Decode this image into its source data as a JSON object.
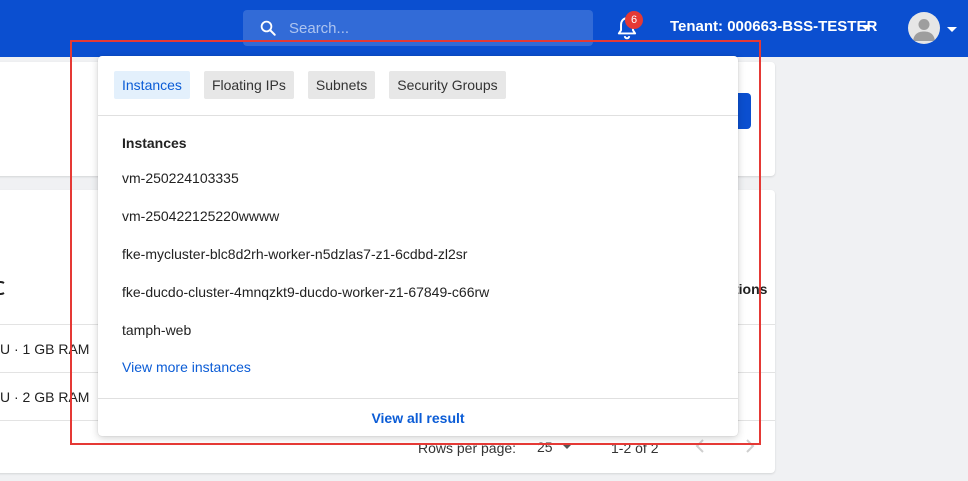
{
  "header": {
    "search_placeholder": "Search...",
    "notification_count": "6",
    "tenant_label": "Tenant: 000663-BSS-TESTER",
    "icons": {
      "search": "search-icon",
      "bell": "bell-icon",
      "avatar": "user-avatar-icon",
      "caret": "caret-down-icon"
    },
    "colors": {
      "brand": "#0b4fd0",
      "badge": "#e53935"
    }
  },
  "background": {
    "column_header_actions": "tions",
    "rows": [
      {
        "spec": "U · 1 GB RAM"
      },
      {
        "spec": "U · 2 GB RAM"
      }
    ],
    "pagination": {
      "rows_per_page_label": "Rows per page:",
      "rows_per_page_value": "25",
      "range": "1-2 of 2"
    }
  },
  "search_dropdown": {
    "tabs": [
      {
        "label": "Instances",
        "active": true
      },
      {
        "label": "Floating IPs",
        "active": false
      },
      {
        "label": "Subnets",
        "active": false
      },
      {
        "label": "Security Groups",
        "active": false
      }
    ],
    "section_title": "Instances",
    "results": [
      "vm-250224103335",
      "vm-250422125220wwww",
      "fke-mycluster-blc8d2rh-worker-n5dzlas7-z1-6cdbd-zl2sr",
      "fke-ducdo-cluster-4mnqzkt9-ducdo-worker-z1-67849-c66rw",
      "tamph-web"
    ],
    "view_more": "View more instances",
    "view_all": "View all result",
    "colors": {
      "active_tab_bg": "#e3f0fc",
      "link": "#0b5cd6"
    }
  },
  "highlight_color": "#e53935"
}
